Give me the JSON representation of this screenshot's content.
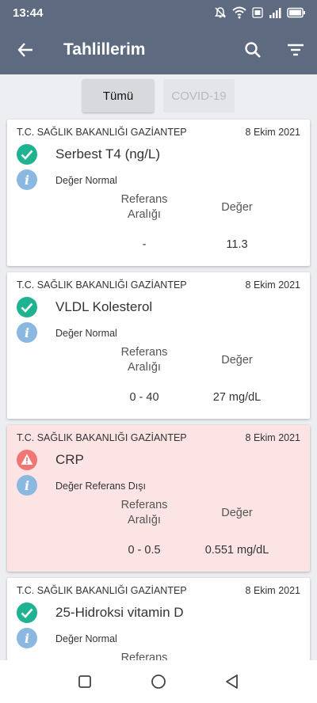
{
  "status_bar": {
    "time": "13:44"
  },
  "header": {
    "title": "Tahlillerim"
  },
  "tabs": [
    {
      "label": "Tümü"
    },
    {
      "label": "COVID-19"
    }
  ],
  "columns": {
    "reference": "Referans Aralığı",
    "value": "Değer"
  },
  "cards": [
    {
      "hospital": "T.C. SAĞLIK BAKANLIĞI GAZİANTEP",
      "date": "8 Ekim 2021",
      "test": "Serbest T4 (ng/L)",
      "result": "Değer Normal",
      "reference": "-",
      "value": "11.3",
      "status": "normal"
    },
    {
      "hospital": "T.C. SAĞLIK BAKANLIĞI GAZİANTEP",
      "date": "8 Ekim 2021",
      "test": "VLDL Kolesterol",
      "result": "Değer Normal",
      "reference": "0 - 40",
      "value": "27 mg/dL",
      "status": "normal"
    },
    {
      "hospital": "T.C. SAĞLIK BAKANLIĞI GAZİANTEP",
      "date": "8 Ekim 2021",
      "test": "CRP",
      "result": "Değer Referans Dışı",
      "reference": "0 - 0.5",
      "value": "0.551 mg/dL",
      "status": "alert"
    },
    {
      "hospital": "T.C. SAĞLIK BAKANLIĞI GAZİANTEP",
      "date": "8 Ekim 2021",
      "test": "25-Hidroksi vitamin D",
      "result": "Değer Normal",
      "reference": "",
      "value": "",
      "status": "normal"
    }
  ],
  "icons": {
    "back": "arrow-left-icon",
    "search": "search-icon",
    "filter": "filter-icon",
    "normal": "check-circle-icon",
    "alert": "warning-icon",
    "info": "info-icon"
  },
  "colors": {
    "app_bar": "#5e6a80",
    "normal": "#1fb391",
    "alert": "#f07673",
    "info": "#8ab8e0",
    "alert_card": "#fde4e4"
  }
}
